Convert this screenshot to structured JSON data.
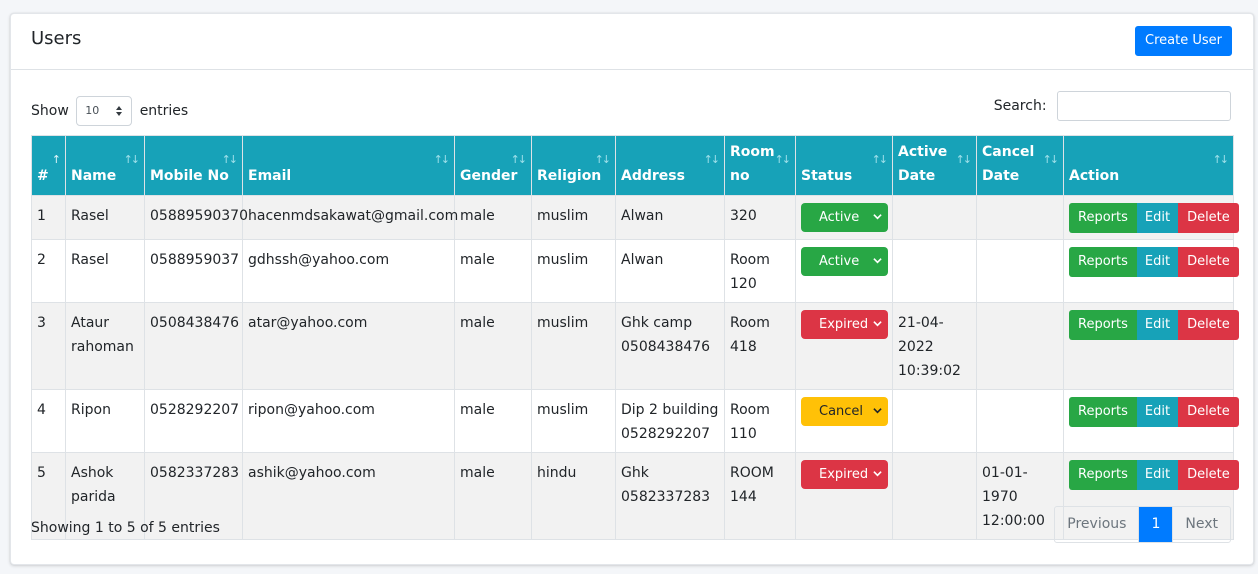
{
  "header": {
    "title": "Users",
    "create_button": "Create User"
  },
  "controls": {
    "show_label": "Show",
    "entries_label": "entries",
    "page_length": "10",
    "search_label": "Search:",
    "search_value": ""
  },
  "table": {
    "columns": [
      "#",
      "Name",
      "Mobile No",
      "Email",
      "Gender",
      "Religion",
      "Address",
      "Room no",
      "Status",
      "Active Date",
      "Cancel Date",
      "Action"
    ],
    "rows": [
      {
        "num": "1",
        "name": "Rasel",
        "mobile": "05889590370",
        "email": "hacenmdsakawat@gmail.com",
        "gender": "male",
        "religion": "muslim",
        "address": "Alwan",
        "room": "320",
        "status": "Active",
        "active_date": "",
        "cancel_date": ""
      },
      {
        "num": "2",
        "name": "Rasel",
        "mobile": "0588959037",
        "email": "gdhssh@yahoo.com",
        "gender": "male",
        "religion": "muslim",
        "address": "Alwan",
        "room": "Room 120",
        "status": "Active",
        "active_date": "",
        "cancel_date": ""
      },
      {
        "num": "3",
        "name": "Ataur rahoman",
        "mobile": "0508438476",
        "email": "atar@yahoo.com",
        "gender": "male",
        "religion": "muslim",
        "address": "Ghk camp 0508438476",
        "room": "Room 418",
        "status": "Expired",
        "active_date": "21-04-2022 10:39:02",
        "cancel_date": ""
      },
      {
        "num": "4",
        "name": "Ripon",
        "mobile": "0528292207",
        "email": "ripon@yahoo.com",
        "gender": "male",
        "religion": "muslim",
        "address": "Dip 2 building 0528292207",
        "room": "Room 110",
        "status": "Cancel",
        "active_date": "",
        "cancel_date": ""
      },
      {
        "num": "5",
        "name": "Ashok parida",
        "mobile": "0582337283",
        "email": "ashik@yahoo.com",
        "gender": "male",
        "religion": "hindu",
        "address": "Ghk 0582337283",
        "room": "ROOM 144",
        "status": "Expired",
        "active_date": "",
        "cancel_date": "01-01-1970 12:00:00"
      }
    ],
    "actions": {
      "reports": "Reports",
      "edit": "Edit",
      "delete": "Delete"
    }
  },
  "footer": {
    "info": "Showing 1 to 5 of 5 entries",
    "prev": "Previous",
    "current_page": "1",
    "next": "Next"
  },
  "colors": {
    "header_bg": "#17a2b8",
    "primary": "#007bff",
    "success": "#28a745",
    "danger": "#dc3545",
    "warning": "#ffc107",
    "info": "#17a2b8"
  }
}
